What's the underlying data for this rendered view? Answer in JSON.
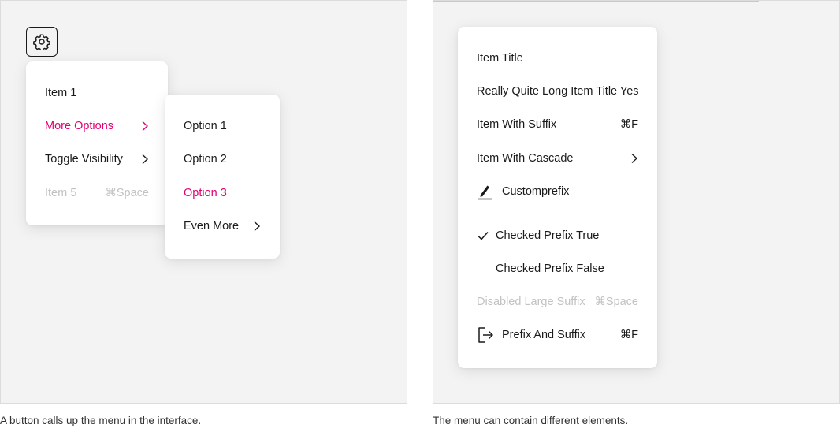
{
  "left_panel": {
    "caption": "A button calls up the menu in the interface.",
    "settings_button": {
      "icon": "gear-icon"
    },
    "menu": {
      "items": [
        {
          "label": "Item 1"
        },
        {
          "label": "More Options",
          "suffix_icon": "chevron-right-icon",
          "state": "active"
        },
        {
          "label": "Toggle Visibility",
          "suffix_icon": "chevron-right-icon"
        },
        {
          "label": "Item 5",
          "suffix": "⌘Space",
          "state": "disabled"
        }
      ]
    },
    "submenu": {
      "items": [
        {
          "label": "Option 1"
        },
        {
          "label": "Option 2"
        },
        {
          "label": "Option 3",
          "state": "active"
        },
        {
          "label": "Even More",
          "suffix_icon": "chevron-right-icon"
        }
      ]
    }
  },
  "right_panel": {
    "caption": "The menu can contain different elements.",
    "menu": {
      "items": [
        {
          "label": "Item Title"
        },
        {
          "label": "Really Quite Long Item Title Yes"
        },
        {
          "label": "Item With Suffix",
          "suffix": "⌘F"
        },
        {
          "label": "Item With Cascade",
          "suffix_icon": "chevron-right-icon"
        },
        {
          "label": "Customprefix",
          "prefix_icon": "pen-icon"
        },
        {
          "label": "Checked Prefix True",
          "prefix_icon": "checkmark-icon",
          "checked": true
        },
        {
          "label": "Checked Prefix False",
          "checked": false
        },
        {
          "label": "Disabled Large Suffix",
          "suffix": "⌘Space",
          "state": "disabled"
        },
        {
          "label": "Prefix And Suffix",
          "prefix_icon": "logout-icon",
          "suffix": "⌘F"
        }
      ]
    }
  },
  "colors": {
    "accent": "#e20074",
    "disabled": "#c2c2c2",
    "panel_bg": "#f3f3f3",
    "text": "#1a1a1a"
  }
}
